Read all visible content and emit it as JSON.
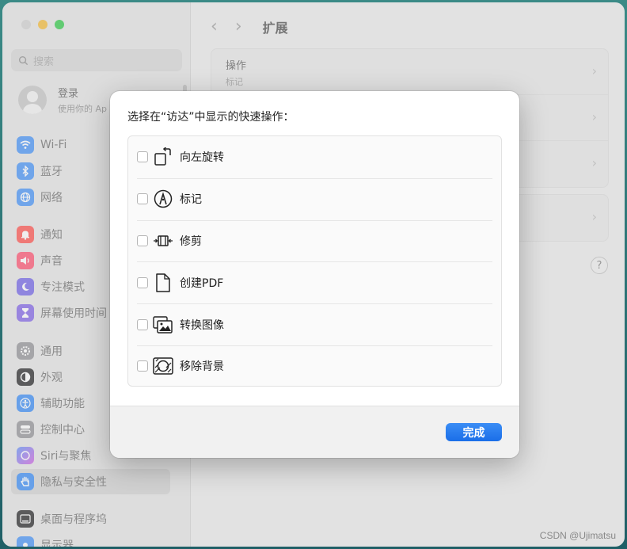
{
  "window": {
    "title": "扩展",
    "search_placeholder": "搜索"
  },
  "account": {
    "title": "登录",
    "subtitle": "使用你的 Ap"
  },
  "sidebar": {
    "items": [
      {
        "label": "Wi-Fi",
        "icon": "wifi-icon",
        "color": "#3d8ef7"
      },
      {
        "label": "蓝牙",
        "icon": "bluetooth-icon",
        "color": "#3d8ef7"
      },
      {
        "label": "网络",
        "icon": "globe-icon",
        "color": "#3d8ef7"
      },
      {
        "label": "通知",
        "icon": "bell-icon",
        "color": "#ff4a45"
      },
      {
        "label": "声音",
        "icon": "speaker-icon",
        "color": "#ff4a6a"
      },
      {
        "label": "专注模式",
        "icon": "moon-icon",
        "color": "#6c5ce7"
      },
      {
        "label": "屏幕使用时间",
        "icon": "hourglass-icon",
        "color": "#7b5ce6"
      },
      {
        "label": "通用",
        "icon": "gear-icon",
        "color": "#8e8e93"
      },
      {
        "label": "外观",
        "icon": "appearance-icon",
        "color": "#1c1c1e"
      },
      {
        "label": "辅助功能",
        "icon": "accessibility-icon",
        "color": "#2f86f6"
      },
      {
        "label": "控制中心",
        "icon": "control-center-icon",
        "color": "#8e8e93"
      },
      {
        "label": "Siri与聚焦",
        "icon": "siri-icon",
        "color": "#b16be8"
      },
      {
        "label": "隐私与安全性",
        "icon": "hand-icon",
        "color": "#2f86f6"
      },
      {
        "label": "桌面与程序坞",
        "icon": "dock-icon",
        "color": "#1c1c1e"
      },
      {
        "label": "显示器",
        "icon": "sun-icon",
        "color": "#3d8ef7"
      }
    ],
    "selected_index": 12
  },
  "main": {
    "rows": [
      {
        "title": "操作",
        "subtitle": "标记"
      }
    ]
  },
  "dialog": {
    "title": "选择在“访达”中显示的快速操作：",
    "options": [
      {
        "label": "向左旋转",
        "icon": "rotate-left-icon",
        "checked": false
      },
      {
        "label": "标记",
        "icon": "markup-icon",
        "checked": false
      },
      {
        "label": "修剪",
        "icon": "trim-icon",
        "checked": false
      },
      {
        "label": "创建PDF",
        "icon": "document-icon",
        "checked": false
      },
      {
        "label": "转换图像",
        "icon": "convert-image-icon",
        "checked": false
      },
      {
        "label": "移除背景",
        "icon": "remove-background-icon",
        "checked": false
      }
    ],
    "done_label": "完成"
  },
  "help_label": "?",
  "watermark": "CSDN @Ujimatsu"
}
